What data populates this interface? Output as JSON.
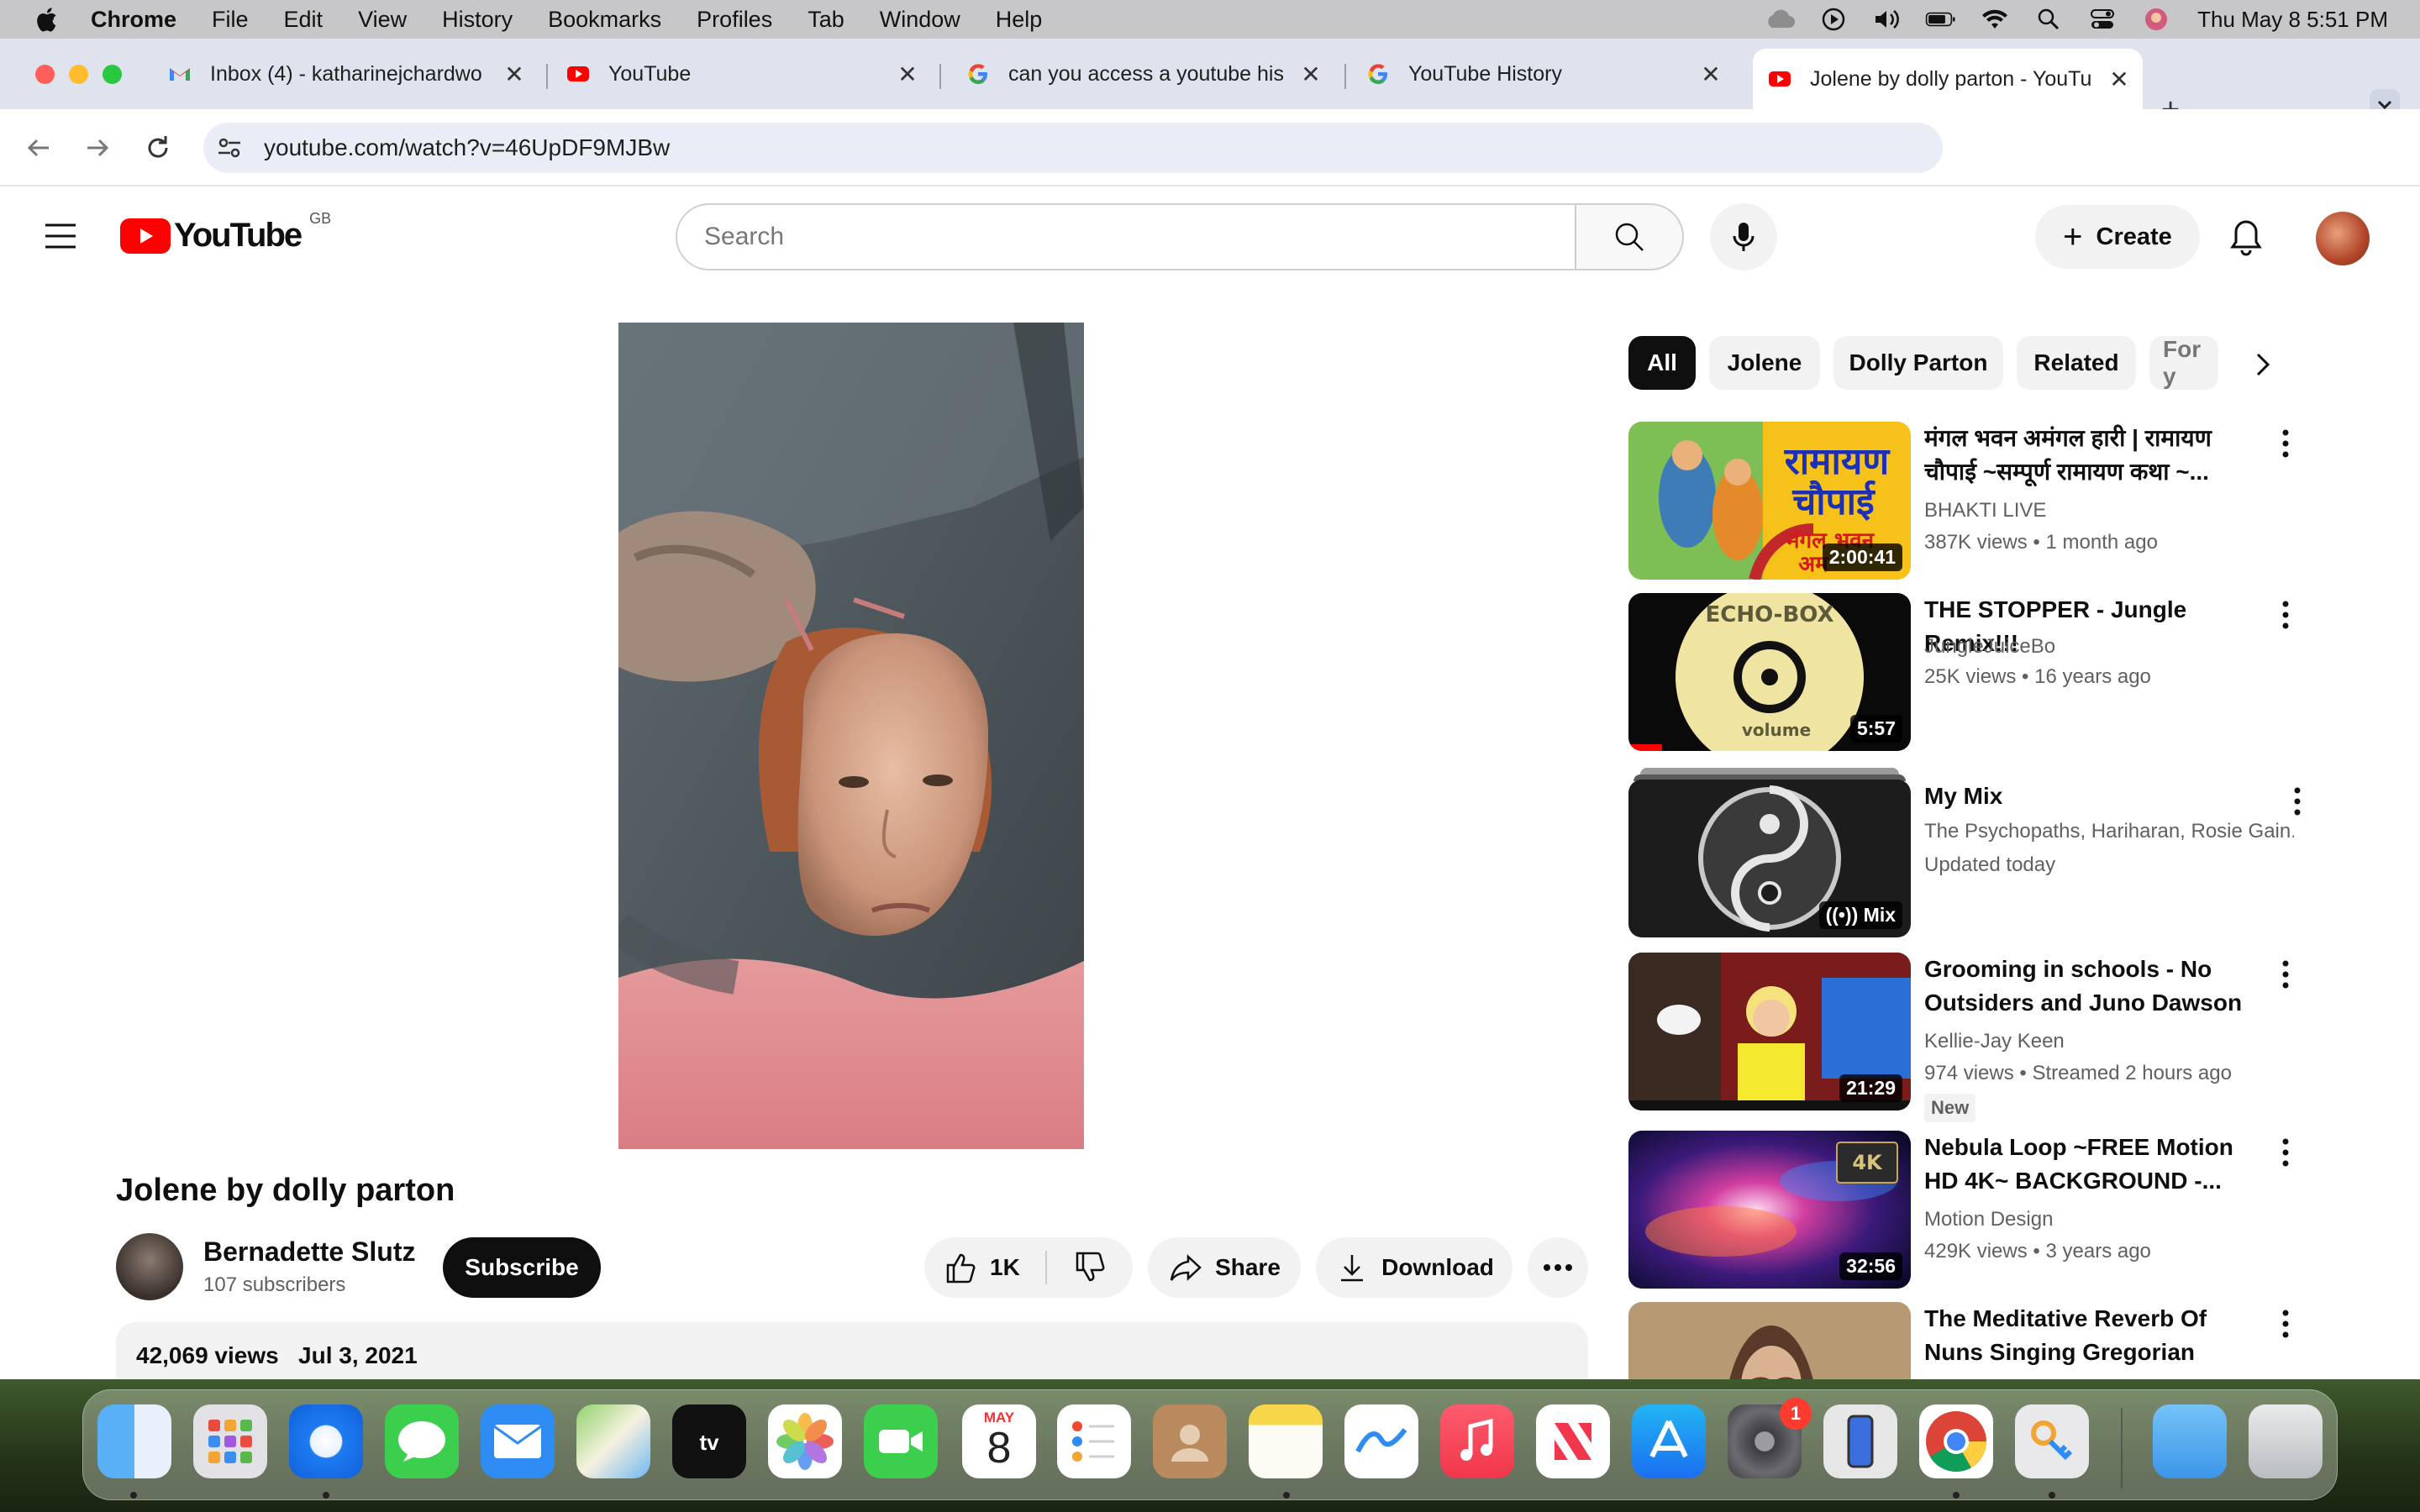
{
  "menubar": {
    "app": "Chrome",
    "items": [
      "File",
      "Edit",
      "View",
      "History",
      "Bookmarks",
      "Profiles",
      "Tab",
      "Window",
      "Help"
    ],
    "clock": "Thu May 8  5:51 PM"
  },
  "tabs": [
    {
      "title": "Inbox (4) - katharinejchardwo",
      "favicon": "gmail-icon"
    },
    {
      "title": "YouTube",
      "favicon": "youtube-icon"
    },
    {
      "title": "can you access a youtube his",
      "favicon": "google-icon"
    },
    {
      "title": "YouTube History",
      "favicon": "google-icon"
    },
    {
      "title": "Jolene by dolly parton - YouTu",
      "favicon": "youtube-icon",
      "active": true
    }
  ],
  "toolbar": {
    "url": "youtube.com/watch?v=46UpDF9MJBw"
  },
  "youtube": {
    "logo_text": "YouTube",
    "country_code": "GB",
    "search_placeholder": "Search",
    "create_label": "Create",
    "accent": "#ff0000"
  },
  "video": {
    "title": "Jolene by dolly parton",
    "channel": "Bernadette Slutz",
    "subscribers": "107 subscribers",
    "subscribe_label": "Subscribe",
    "likes": "1K",
    "share_label": "Share",
    "download_label": "Download",
    "views": "42,069 views",
    "date": "Jul 3, 2021"
  },
  "chips": [
    "All",
    "Jolene",
    "Dolly Parton",
    "Related",
    "For y"
  ],
  "recommendations": [
    {
      "title": "मंगल भवन अमंगल हारी | रामायण चौपाई ~सम्पूर्ण रामायण कथा ~...",
      "channel": "BHAKTI LIVE",
      "views": "387K views",
      "age": "1 month ago",
      "duration": "2:00:41",
      "thumb_text_1": "रामायण",
      "thumb_text_2": "चौपाई",
      "thumb_text_3": "मंगल भवन",
      "thumb_text_4": "अम"
    },
    {
      "title": "THE STOPPER - Jungle Remix!!!",
      "channel": "JungleJuiceBo",
      "views": "25K views",
      "age": "16 years ago",
      "duration": "5:57",
      "thumb_text_1": "ECHO-BOX",
      "thumb_text_2": "volume"
    },
    {
      "title": "My Mix",
      "channel": "The Psychopaths, Hariharan, Rosie Gain...",
      "meta": "Updated today",
      "duration": "Mix"
    },
    {
      "title": "Grooming in schools - No Outsiders and Juno Dawson",
      "channel": "Kellie-Jay Keen",
      "views": "974 views",
      "age": "Streamed 2 hours ago",
      "badge": "New",
      "duration": "21:29"
    },
    {
      "title": "Nebula Loop ~FREE Motion HD 4K~ BACKGROUND -...",
      "channel": "Motion Design",
      "views": "429K views",
      "age": "3 years ago",
      "duration": "32:56",
      "thumb_text_1": "4K"
    },
    {
      "title": "The Meditative Reverb Of Nuns Singing Gregorian Chants"
    }
  ],
  "dock": {
    "calendar_month": "MAY",
    "calendar_day": "8",
    "settings_badge": "1",
    "apps": [
      "finder-icon",
      "launchpad-icon",
      "safari-icon",
      "messages-icon",
      "mail-icon",
      "maps-icon",
      "apple-tv-icon",
      "photos-icon",
      "facetime-icon",
      "calendar-icon",
      "reminders-icon",
      "contacts-icon",
      "notes-icon",
      "freeform-icon",
      "music-icon",
      "news-icon",
      "app-store-icon",
      "system-settings-icon",
      "iphone-mirroring-icon",
      "chrome-icon",
      "keychain-icon",
      "folder-icon",
      "trash-icon"
    ]
  }
}
